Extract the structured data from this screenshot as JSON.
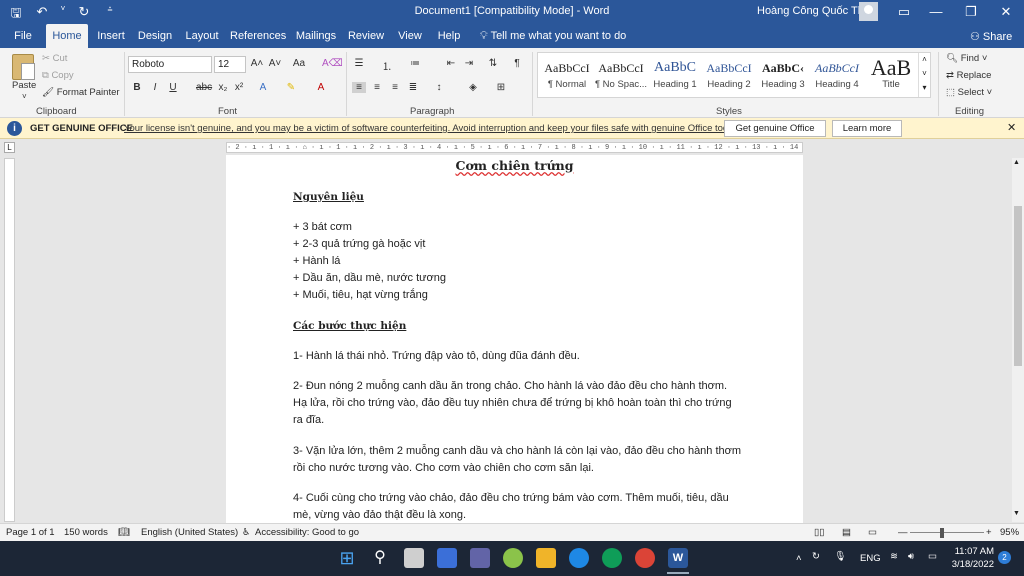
{
  "titlebar": {
    "title": "Document1 [Compatibility Mode]  -  Word",
    "user": "Hoàng Công Quốc Thái",
    "qat": [
      "save-icon",
      "undo-icon",
      "redo-icon",
      "customize-icon"
    ]
  },
  "tabs": [
    "File",
    "Home",
    "Insert",
    "Design",
    "Layout",
    "References",
    "Mailings",
    "Review",
    "View",
    "Help"
  ],
  "tellme": "Tell me what you want to do",
  "share": "Share",
  "ribbon": {
    "clipboard": {
      "paste": "Paste",
      "cut": "Cut",
      "copy": "Copy",
      "format_painter": "Format Painter",
      "label": "Clipboard"
    },
    "font": {
      "name": "Roboto",
      "size": "12",
      "label": "Font"
    },
    "paragraph": {
      "label": "Paragraph"
    },
    "styles": {
      "label": "Styles",
      "items": [
        {
          "preview": "AaBbCcI",
          "name": "¶ Normal"
        },
        {
          "preview": "AaBbCcI",
          "name": "¶ No Spac..."
        },
        {
          "preview": "AaBbC",
          "name": "Heading 1"
        },
        {
          "preview": "AaBbCcI",
          "name": "Heading 2"
        },
        {
          "preview": "AaBbC‹",
          "name": "Heading 3"
        },
        {
          "preview": "AaBbCcI",
          "name": "Heading 4"
        },
        {
          "preview": "AaB",
          "name": "Title"
        }
      ]
    },
    "editing": {
      "find": "Find",
      "replace": "Replace",
      "select": "Select",
      "label": "Editing"
    }
  },
  "message_bar": {
    "label": "GET GENUINE OFFICE",
    "text": "Your license isn't genuine, and you may be a victim of software counterfeiting. Avoid interruption and keep your files safe with genuine Office today.",
    "btn1": "Get genuine Office",
    "btn2": "Learn more"
  },
  "ruler": "· 2 · ı · 1 · ı · ⌂ · ı · 1 · ı · 2 · ı · 3 · ı · 4 · ı · 5 · ı · 6 · ı · 7 · ı · 8 · ı · 9 · ı · 10 · ı · 11 · ı · 12 · ı · 13 · ı · 14 · ı · 15 · ı · 16 · ⌂ · 17 · ı · 18 · ı · 19",
  "document": {
    "title": "Cơm chiên trứng",
    "section1": "Nguyên liệu",
    "ingredients": [
      "+ 3 bát cơm",
      "+ 2-3 quả trứng gà hoặc vịt",
      "+ Hành lá",
      "+ Dầu ăn, dầu mè, nước tương",
      "+ Muối, tiêu, hạt vừng trắng"
    ],
    "section2": "Các bước thực hiện",
    "steps": [
      "1- Hành lá thái nhỏ. Trứng đập vào tô, dùng đũa đánh đều.",
      "2- Đun nóng 2 muỗng canh dầu ăn trong chảo. Cho hành lá vào đảo đều cho hành thơm. Hạ lửa, rồi cho trứng vào, đảo đều tuy nhiên chưa để trứng bị khô hoàn toàn thì cho trứng ra đĩa.",
      "3- Vặn lửa lớn, thêm 2 muỗng canh dầu và cho hành lá còn lại vào, đảo đều cho hành thơm rồi cho nước tương vào. Cho cơm vào chiên cho cơm săn lại.",
      "4- Cuối cùng cho trứng vào chảo, đảo đều cho trứng bám vào cơm. Thêm muối, tiêu, dầu mè, vừng vào đảo thật đều là xong."
    ]
  },
  "statusbar": {
    "page": "Page 1 of 1",
    "words": "150 words",
    "language": "English (United States)",
    "accessibility": "Accessibility: Good to go",
    "zoom": "95%"
  },
  "taskbar": {
    "lang": "ENG",
    "time": "11:07 AM",
    "date": "3/18/2022",
    "badge": "2"
  }
}
